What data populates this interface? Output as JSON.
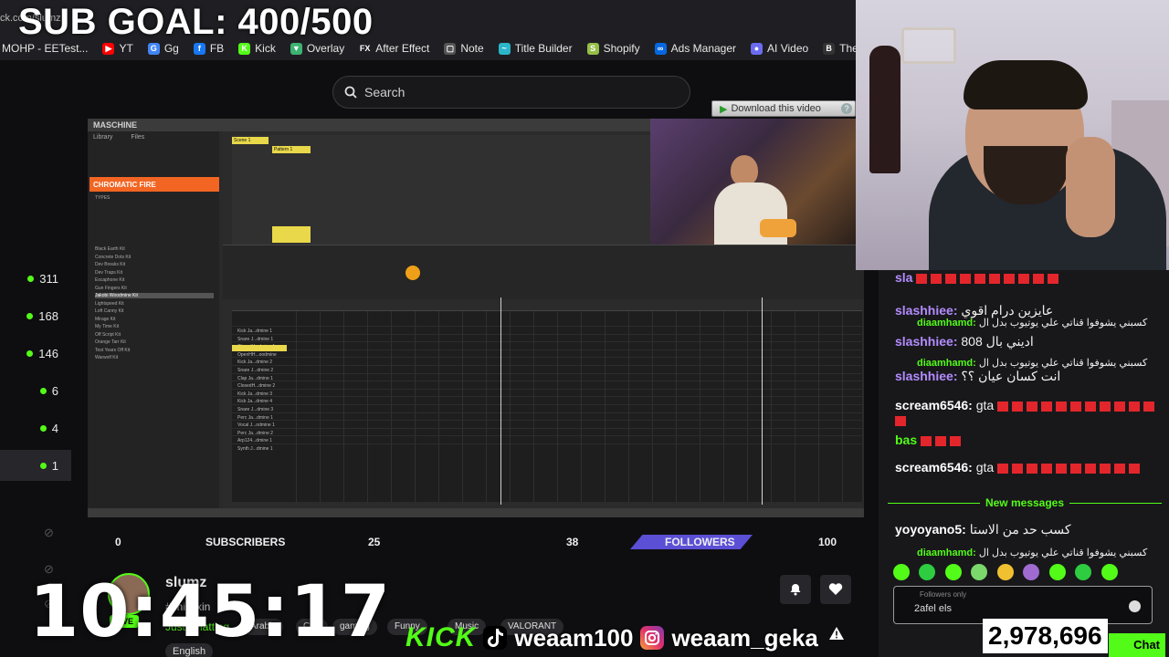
{
  "browser": {
    "url": "ck.com/slumz",
    "bookmarks": [
      {
        "label": "MOHP - EETest...",
        "icon": "",
        "color": "#1f1f23"
      },
      {
        "label": "YT",
        "icon": "▶",
        "color": "#ff0000"
      },
      {
        "label": "Gg",
        "icon": "G",
        "color": "#4285f4"
      },
      {
        "label": "FB",
        "icon": "f",
        "color": "#1877f2"
      },
      {
        "label": "Kick",
        "icon": "K",
        "color": "#53fc18"
      },
      {
        "label": "Overlay",
        "icon": "▼",
        "color": "#3cb371"
      },
      {
        "label": "After Effect",
        "icon": "FX",
        "color": "#1f1f23"
      },
      {
        "label": "Note",
        "icon": "▢",
        "color": "#555"
      },
      {
        "label": "Title Builder",
        "icon": "~",
        "color": "#2bb6c9"
      },
      {
        "label": "Shopify",
        "icon": "S",
        "color": "#95bf47"
      },
      {
        "label": "Ads Manager",
        "icon": "∞",
        "color": "#0668e1"
      },
      {
        "label": "AI Video",
        "icon": "●",
        "color": "#6b6bf0"
      },
      {
        "label": "The Bus",
        "icon": "B",
        "color": "#333"
      }
    ]
  },
  "overlay": {
    "sub_goal": "SUB GOAL: 400/500",
    "clock": "10:45:17",
    "kick_logo": "KICK",
    "tiktok_handle": "weaam100",
    "instagram_handle": "weaam_geka"
  },
  "rail": {
    "items": [
      "311",
      "168",
      "146",
      "6",
      "4",
      "1"
    ]
  },
  "search": {
    "placeholder": "Search"
  },
  "player": {
    "app_name": "MASCHINE",
    "library_tab": "Library",
    "files_tab": "Files",
    "category": "CHROMATIC FIRE",
    "types_label": "TYPES",
    "kits": [
      "Black Earth Kit",
      "Concrete Dots Kit",
      "Dev Breaks Kit",
      "Dev Traps Kit",
      "Escaphone Kit",
      "Gun Fingers Kit",
      "Jakobi Woodmine Kit",
      "Lightspeed Kit",
      "Loft Canny Kit",
      "Mirage Kit",
      "My Time Kit",
      "Off Script Kit",
      "Orange Tarr Kit",
      "Test Years Off Kit",
      "Warwolf Kit"
    ],
    "scene_label": "Scene 1",
    "pattern_label": "Pattern 1",
    "tracks": [
      "Kick Ja...dmine 1",
      "Snare J...dmine 1",
      "ClosedH...dmine 1",
      "OpenHH...oodmine",
      "Kick Ja...dmine 2",
      "Snare J...dmine 2",
      "Clap Ja...dmine 1",
      "ClosedH...dmine 2",
      "Kick Ja...dmine 3",
      "Kick Ja...dmine 4",
      "Snare J...dmine 3",
      "Perc Ja...dmine 1",
      "Vocal J...odmine 1",
      "Perc Ja...dmine 2",
      "Arp124...dmine 1",
      "Synth J...dmine 1"
    ],
    "download_button": "Download this video",
    "help": "?"
  },
  "goal": {
    "start_label": "0",
    "sub_label": "SUBSCRIBERS",
    "sub_target": "25",
    "follow_current": "38",
    "follow_label": "FOLLOWERS",
    "follow_target": "100",
    "follow_progress": 0.38
  },
  "channel": {
    "name": "slumz",
    "title": "#chillaxin",
    "category": "Just Chatting",
    "live_label": "LIVE",
    "tags": [
      "Arabic",
      "Chill",
      "gaming",
      "Funny",
      "Music",
      "VALORANT"
    ],
    "language": "English"
  },
  "chat": {
    "messages": [
      {
        "user": "sla",
        "color": "#b48cff",
        "text": "",
        "redacted": 10
      },
      {
        "user": "slashhiee:",
        "color": "#b48cff",
        "text": "عايزين درام اقوي",
        "redacted": 0
      },
      {
        "user": "diaamhamd:",
        "color": "#53fc18",
        "text": "كسبني يشوفوا قناتي علي يوتيوب بدل ال",
        "redacted": 0
      },
      {
        "user": "slashhiee:",
        "color": "#b48cff",
        "text": "808 اديني بال",
        "redacted": 0
      },
      {
        "user": "diaamhamd:",
        "color": "#53fc18",
        "text": "كسبني يشوفوا قناتي علي يوتيوب بدل ال",
        "redacted": 0
      },
      {
        "user": "slashhiee:",
        "color": "#b48cff",
        "text": "انت كسان عيان ؟؟",
        "redacted": 0
      },
      {
        "user": "scream6546:",
        "color": "#ffffff",
        "text": "gta",
        "redacted": 12
      },
      {
        "user": "bas",
        "color": "#53fc18",
        "text": "",
        "redacted": 3
      },
      {
        "user": "scream6546:",
        "color": "#ffffff",
        "text": "gta",
        "redacted": 10
      },
      {
        "user": "yoyoyano5:",
        "color": "#ffffff",
        "text": "كسب حد من الاستا",
        "redacted": 0
      },
      {
        "user": "diaamhamd:",
        "color": "#53fc18",
        "text": "كسبني يشوفوا قناتي علي يوتيوب بدل ال",
        "redacted": 0
      }
    ],
    "new_messages": "New messages",
    "followers_only": "Followers only",
    "input_value": "2afel els",
    "viewer_count": "2,978,696",
    "chat_button": "Chat"
  },
  "colors": {
    "kick_green": "#53fc18",
    "maschine_orange": "#f26522",
    "goal_purple": "#5b4fd6"
  }
}
